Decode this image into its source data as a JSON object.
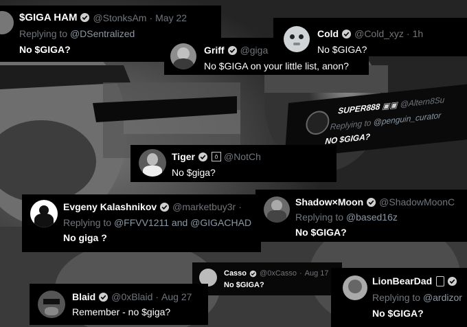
{
  "tweets": [
    {
      "name": "$GIGA HAM",
      "handle": "@StonksAm",
      "time": "May 22",
      "reply_prefix": "Replying to",
      "reply_to": "@DSentralized",
      "text": "No $GIGA?"
    },
    {
      "name": "Cold",
      "handle": "@Cold_xyz",
      "time": "1h",
      "text": "No $GIGA?"
    },
    {
      "name": "Griff",
      "handle": "@giga",
      "text": "No $GIGA on your little list, anon?"
    },
    {
      "name": "SUPER888",
      "handle": "@Altern8Su",
      "reply_prefix": "Replying to",
      "reply_to": "@penguin_curator",
      "text": "NO $GIGA?"
    },
    {
      "name": "Tiger",
      "handle": "@NotCh",
      "text": "No $giga?"
    },
    {
      "name": "Evgeny Kalashnikov",
      "handle": "@marketbuy3r",
      "reply_prefix": "Replying to",
      "reply_to": "@FFVV1211 and @GIGACHAD",
      "text": "No giga ?"
    },
    {
      "name": "Shadow×Moon",
      "handle": "@ShadowMoonC",
      "reply_prefix": "Replying to",
      "reply_to": "@based16z",
      "text": "No $GIGA?"
    },
    {
      "name": "Casso",
      "handle": "@0xCasso",
      "time": "Aug 17",
      "text": "No $GIGA?"
    },
    {
      "name": "Blaid",
      "handle": "@0xBlaid",
      "time": "Aug 27",
      "text": "Remember - no $giga?"
    },
    {
      "name": "LionBearDad",
      "handle": "",
      "reply_prefix": "Replying to",
      "reply_to": "@ardizor",
      "text": "No $GIGA?"
    }
  ],
  "sep": "·"
}
